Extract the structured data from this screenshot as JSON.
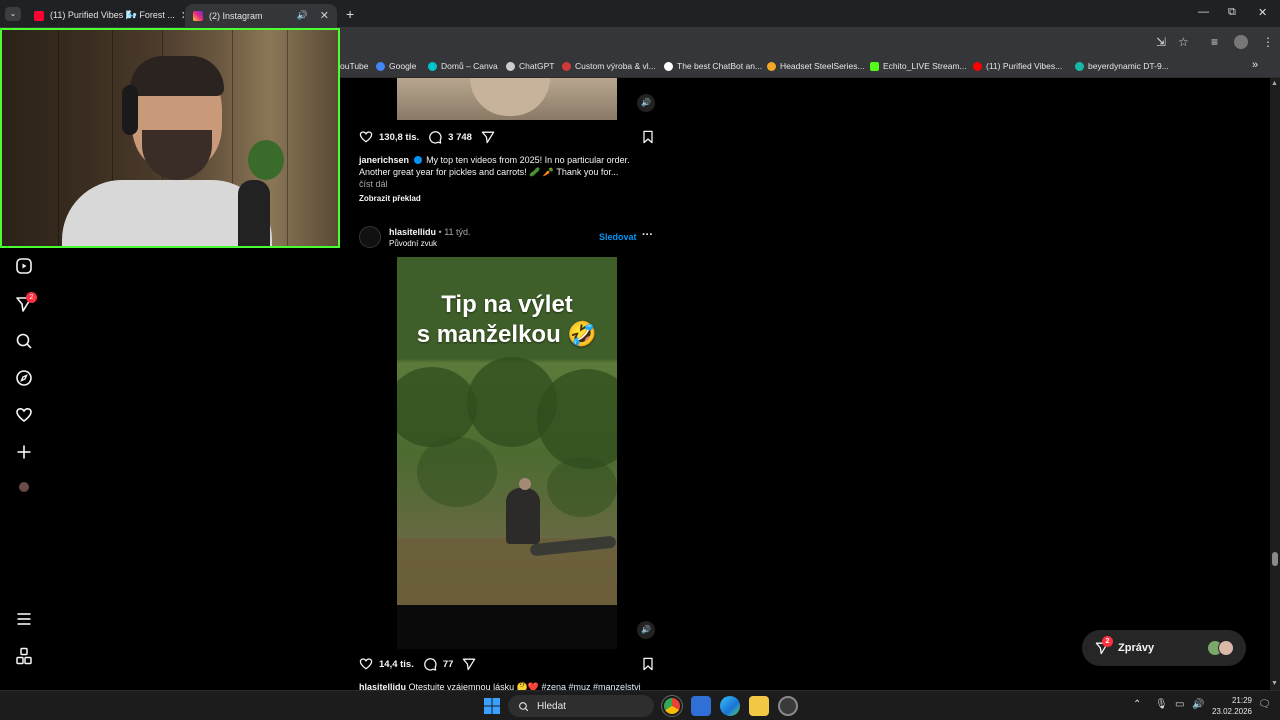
{
  "browser": {
    "tabs": [
      {
        "title": "(11) Purified Vibes 🌬️ Forest ...",
        "active": false,
        "favicon_color": "#ff0033"
      },
      {
        "title": "(2) Instagram",
        "active": true,
        "favicon_color": "#e1306c"
      }
    ],
    "tab_list_icon": "chevron-down-icon",
    "new_tab_label": "+",
    "window_controls": {
      "minimize": "—",
      "restore": "⧉",
      "close": "✕"
    },
    "bookmarks": [
      {
        "label": "ouTube",
        "color": "#ff0000"
      },
      {
        "label": "Google",
        "color": "#4285f4"
      },
      {
        "label": "Domů – Canva",
        "color": "#00c4cc"
      },
      {
        "label": "ChatGPT",
        "color": "#cccccc"
      },
      {
        "label": "Custom výroba & vl...",
        "color": "#d23a3a"
      },
      {
        "label": "The best ChatBot an...",
        "color": "#ffffff"
      },
      {
        "label": "Headset SteelSeries...",
        "color": "#f5a623"
      },
      {
        "label": "Echito_LIVE Stream...",
        "color": "#53fc18"
      },
      {
        "label": "(11) Purified Vibes...",
        "color": "#ff0000"
      },
      {
        "label": "beyerdynamic DT-9...",
        "color": "#17b8a6"
      }
    ],
    "bookmarks_more": "»"
  },
  "sidebar": {
    "notification_count": "2"
  },
  "feed": {
    "post1": {
      "likes": "130,8 tis.",
      "comments": "3 748",
      "username": "janerichsen",
      "caption": "My top ten videos from 2025! In no particular order. Another great year for pickles and carrots! 🥒 🥕 Thank you for...",
      "read_more": "číst dál",
      "translate": "Zobrazit překlad"
    },
    "post2": {
      "username": "hlasitellidu",
      "time": "11 týd.",
      "audio": "Původní zvuk",
      "follow_label": "Sledovat",
      "more_label": "···",
      "video_title_line1": "Tip na výlet",
      "video_title_line2": "s manželkou 🤣",
      "likes": "14,4 tis.",
      "comments": "77",
      "caption_username": "hlasitellidu",
      "caption": "Otestujte vzájemnou lásku 🤔❤️",
      "hashtags": "#zena #muz #manzelstvi"
    }
  },
  "messages": {
    "label": "Zprávy",
    "count": "2"
  },
  "taskbar": {
    "search_placeholder": "Hledat",
    "time": "21:29",
    "date": "23.02.2026"
  }
}
